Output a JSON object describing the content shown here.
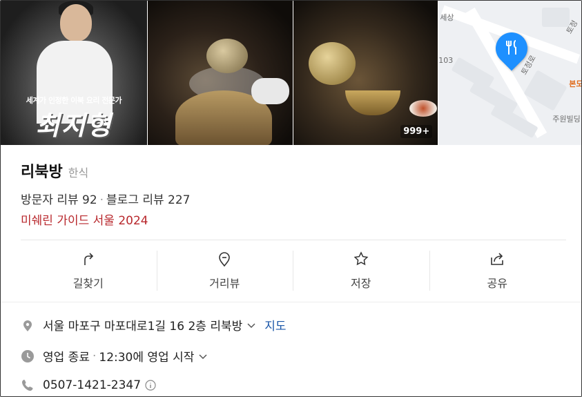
{
  "photos": {
    "chef_tagline": "세계가 인정한 이북 요리 전문가",
    "chef_name": "최지형",
    "photo_count": "999+"
  },
  "map": {
    "labels": [
      "세상",
      "토정",
      "103",
      "토정로",
      "본도",
      "주원빌딩"
    ]
  },
  "place": {
    "name": "리북방",
    "category": "한식",
    "visitor_reviews": "방문자 리뷰 92",
    "blog_reviews": "블로그 리뷰 227",
    "michelin": "미쉐린 가이드 서울 2024"
  },
  "actions": [
    {
      "label": "길찾기",
      "icon": "directions-icon"
    },
    {
      "label": "거리뷰",
      "icon": "streetview-icon"
    },
    {
      "label": "저장",
      "icon": "star-icon"
    },
    {
      "label": "공유",
      "icon": "share-icon"
    }
  ],
  "details": {
    "address": "서울 마포구 마포대로1길 16 2층 리북방",
    "map_link": "지도",
    "status": "영업 종료",
    "hours": "12:30에 영업 시작",
    "phone": "0507-1421-2347"
  },
  "colors": {
    "michelin": "#b8272c",
    "link": "#1a56a8",
    "pin": "#1e90ff"
  }
}
